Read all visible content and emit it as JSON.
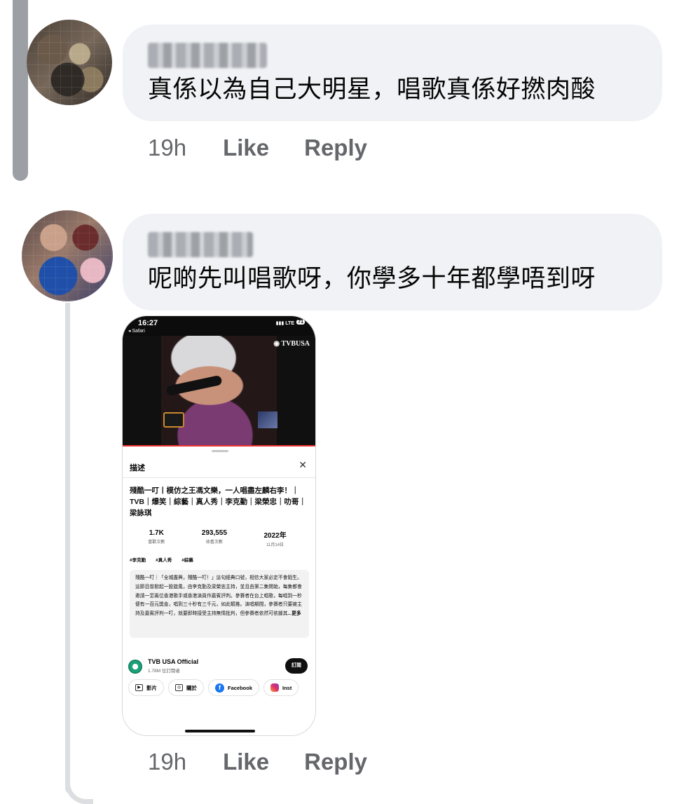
{
  "comments": [
    {
      "author": "",
      "text": "真係以為自己大明星，唱歌真係好撚肉酸",
      "time": "19h",
      "like_label": "Like",
      "reply_label": "Reply"
    },
    {
      "author": "",
      "text": "呢啲先叫唱歌呀，你學多十年都學唔到呀",
      "time": "19h",
      "like_label": "Like",
      "reply_label": "Reply"
    }
  ],
  "attachment": {
    "status_time": "16:27",
    "status_back": "◂ Safari",
    "network": "LTE",
    "battery": "71",
    "channel_logo_text": "TVBUSA",
    "panel_title": "描述",
    "close_glyph": "✕",
    "video_title": "殘酷一叮丨模仿之王馮文樂，一人唱盡左麟右李！｜TVB｜爆笑｜綜藝｜真人秀｜李克勤｜梁榮忠｜叻哥｜梁詠琪",
    "stats": [
      {
        "value": "1.7K",
        "label": "喜歡次數"
      },
      {
        "value": "293,555",
        "label": "收看次數"
      },
      {
        "value": "2022年",
        "label": "11月14日"
      }
    ],
    "tags": [
      "#李克勤",
      "#真人秀",
      "#綜藝"
    ],
    "description": "殘酷一叮｜「全城盡興，殘酷一叮！」這句經典口號，相信大家必定不會陌生。這節目曾掀起一股旋風，由李克勤及梁榮忠主持，並且由第二集開始，每集都會邀請一至兩位香港歌手或香港演員作嘉賓評判。參賽者在台上唱歌，每唱到一秒便有一百元獎金，唱到三十秒有三千元，如此類推。演唱期間，參賽者只要被主持及嘉賓評判一叮，就要即時接受主持無情批判，但參賽者依然可依據其",
    "description_more": "...更多",
    "channel_name": "TVB USA Official",
    "channel_subs": "1.78M 位訂閱者",
    "subscribe_label": "訂閱",
    "links": [
      {
        "icon": "video-icon",
        "label": "影片"
      },
      {
        "icon": "about-icon",
        "label": "關於"
      },
      {
        "icon": "facebook-icon",
        "label": "Facebook"
      },
      {
        "icon": "instagram-icon",
        "label": "Inst"
      }
    ]
  },
  "colors": {
    "bubble": "#f0f2f5",
    "meta_text": "#65676b",
    "thread_line": "#dcdee2"
  }
}
